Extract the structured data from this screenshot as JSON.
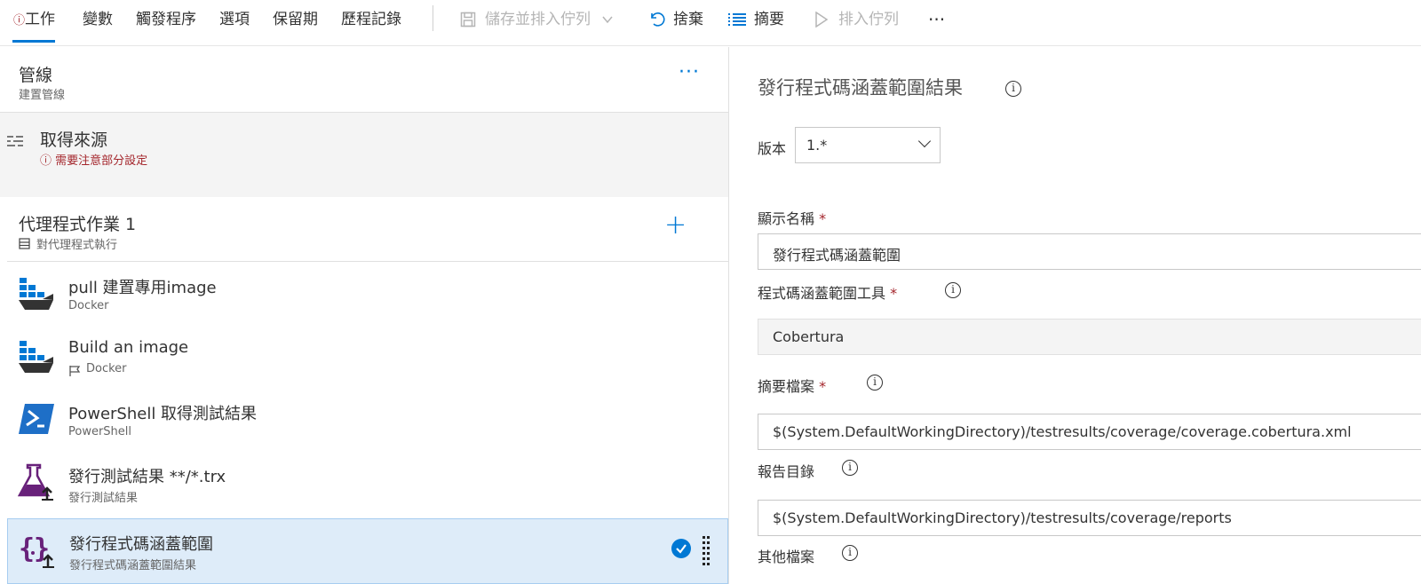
{
  "toolbar": {
    "tabs": [
      {
        "label": "工作",
        "warning": "ⓘ"
      },
      {
        "label": "變數"
      },
      {
        "label": "觸發程序"
      },
      {
        "label": "選項"
      },
      {
        "label": "保留期"
      },
      {
        "label": "歷程記錄"
      }
    ],
    "save_queue_label": "儲存並排入佇列",
    "discard_label": "捨棄",
    "summary_label": "摘要",
    "queue_label": "排入佇列",
    "more_label": "···"
  },
  "pipeline": {
    "title": "管線",
    "subtitle": "建置管線"
  },
  "source": {
    "title": "取得來源",
    "warning": "ⓘ 需要注意部分設定"
  },
  "agent_job": {
    "title": "代理程式作業 1",
    "subtitle": "對代理程式執行"
  },
  "tasks": [
    {
      "name": "pull 建置專用image",
      "sub": "Docker",
      "icon": "docker-icon"
    },
    {
      "name": "Build an image",
      "sub": "Docker",
      "icon": "docker-icon"
    },
    {
      "name": "PowerShell 取得測試結果",
      "sub": "PowerShell",
      "icon": "powershell-icon"
    },
    {
      "name": "發行測試結果 **/*.trx",
      "sub": "發行測試結果",
      "icon": "flask-upload-icon"
    },
    {
      "name": "發行程式碼涵蓋範圍",
      "sub": "發行程式碼涵蓋範圍結果",
      "icon": "braces-upload-icon"
    }
  ],
  "detail": {
    "title": "發行程式碼涵蓋範圍結果",
    "version_label": "版本",
    "version_value": "1.*",
    "display_name_label": "顯示名稱",
    "display_name_value": "發行程式碼涵蓋範圍",
    "tool_label": "程式碼涵蓋範圍工具",
    "tool_value": "Cobertura",
    "summary_file_label": "摘要檔案",
    "summary_file_value": "$(System.DefaultWorkingDirectory)/testresults/coverage/coverage.cobertura.xml",
    "report_dir_label": "報告目錄",
    "report_dir_value": "$(System.DefaultWorkingDirectory)/testresults/coverage/reports",
    "other_files_label": "其他檔案",
    "required_mark": "*"
  },
  "colors": {
    "accent": "#0078d4",
    "warning": "#a4262c",
    "selected_bg": "#deecf9"
  }
}
